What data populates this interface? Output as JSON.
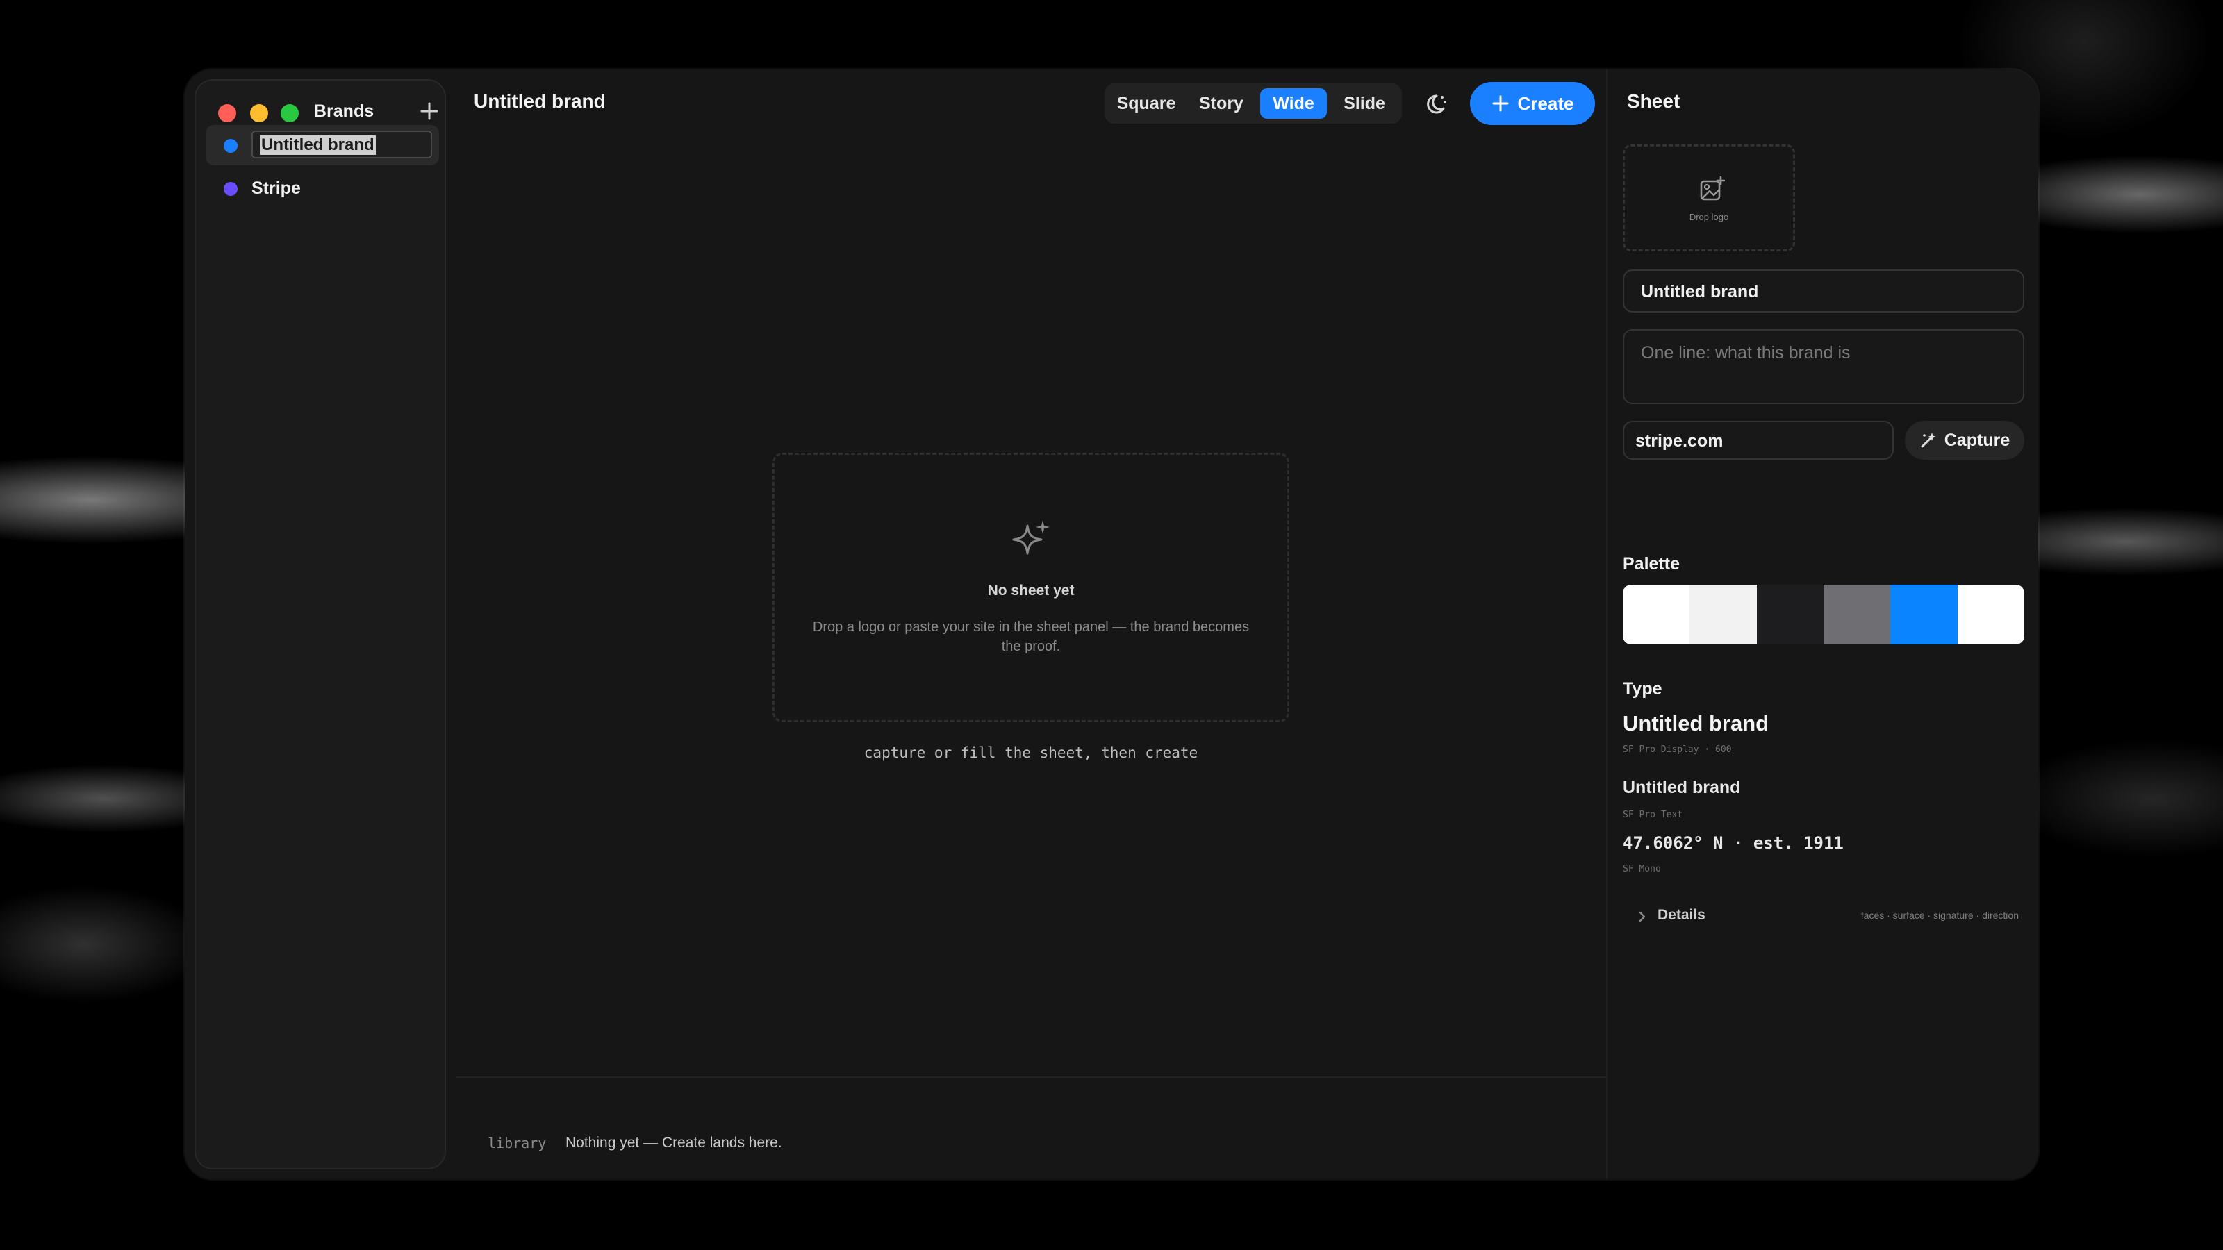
{
  "sidebar": {
    "title": "Brands",
    "brands": [
      {
        "label": "Untitled brand",
        "color": "#1a80ff",
        "editing": true
      },
      {
        "label": "Stripe",
        "color": "#6b4cff",
        "editing": false
      }
    ]
  },
  "header": {
    "title": "Untitled brand",
    "formats": [
      "Square",
      "Story",
      "Wide",
      "Slide"
    ],
    "active_format": "Wide",
    "create_label": "Create"
  },
  "canvas": {
    "empty_title": "No sheet yet",
    "empty_desc": "Drop a logo or paste your site in the sheet panel — the brand becomes the proof.",
    "hint": "capture or fill the sheet, then create"
  },
  "library": {
    "label": "library",
    "text": "Nothing yet — Create lands here."
  },
  "sheet": {
    "title": "Sheet",
    "logo_drop_label": "Drop logo",
    "name_value": "Untitled brand",
    "description_placeholder": "One line: what this brand is",
    "url_value": "stripe.com",
    "capture_label": "Capture",
    "palette_label": "Palette",
    "palette": [
      "#ffffff",
      "#f2f2f3",
      "#1d1d1f",
      "#6e6e73",
      "#0a84ff",
      "#ffffff"
    ],
    "type_label": "Type",
    "type_samples": {
      "display": "Untitled brand",
      "display_caption": "SF Pro Display · 600",
      "text": "Untitled brand",
      "text_caption": "SF Pro Text",
      "mono": "47.6062° N · est. 1911",
      "mono_caption": "SF Mono"
    },
    "details_label": "Details",
    "details_meta": "faces · surface · signature · direction"
  },
  "colors": {
    "accent": "#1a80ff",
    "window_bg": "#161616"
  }
}
